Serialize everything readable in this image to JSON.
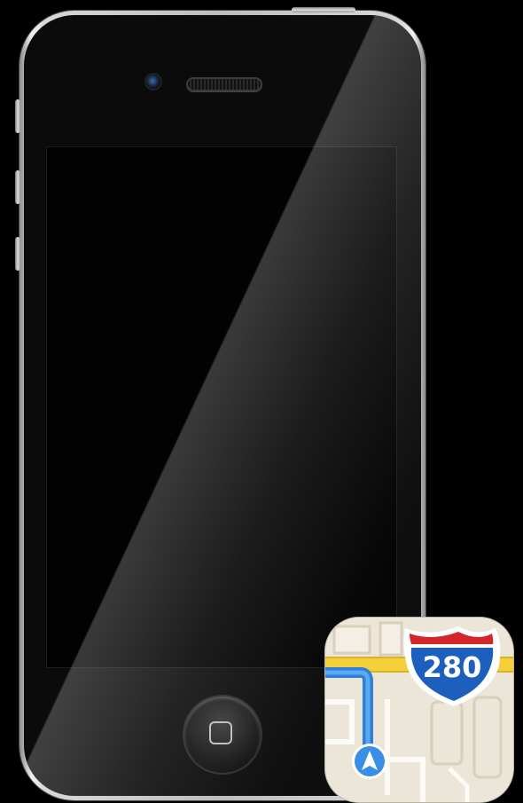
{
  "device": {
    "model_label": "iPhone",
    "screen_state": "off"
  },
  "app_icon": {
    "name": "Maps",
    "shield_number": "280",
    "colors": {
      "shield_blue": "#1d5fbd",
      "shield_red": "#d2262b",
      "road_yellow": "#f5cf3a",
      "route_blue": "#3a8ee6",
      "land": "#ece6d8"
    }
  },
  "icons": {
    "camera": "camera-icon",
    "speaker": "speaker-grille",
    "home": "home-square-icon",
    "location": "location-arrow-icon"
  }
}
